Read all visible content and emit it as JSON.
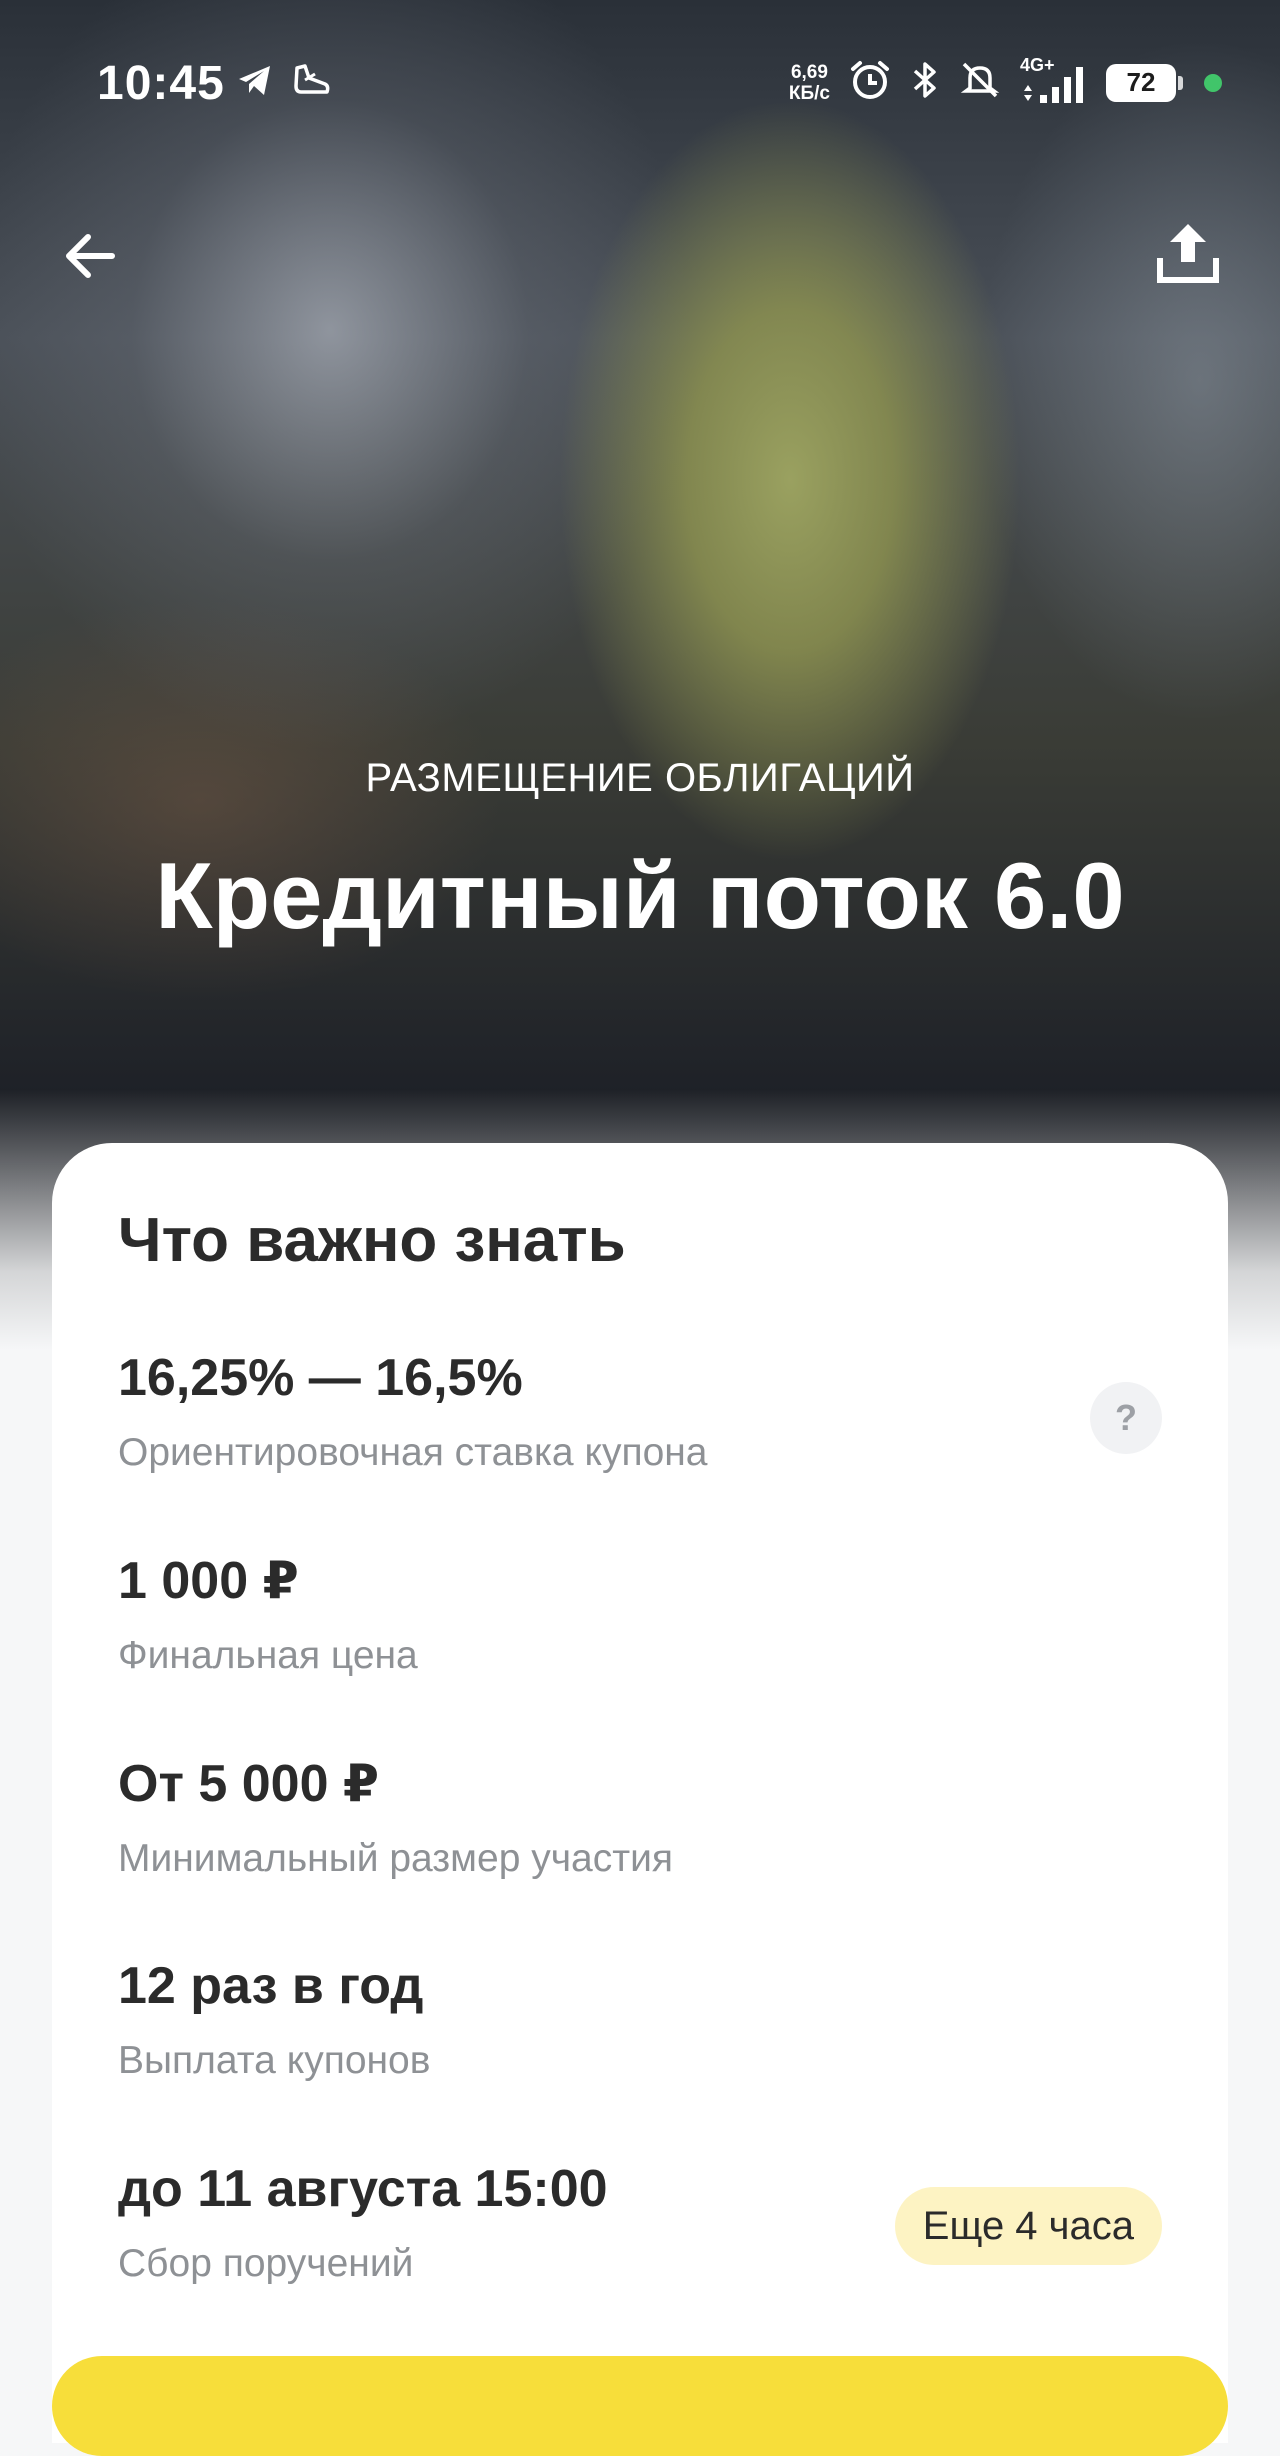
{
  "status_bar": {
    "time": "10:45",
    "net_speed_value": "6,69",
    "net_speed_unit": "КБ/с",
    "network_type": "4G+",
    "battery_level": "72",
    "icons": [
      "telegram-icon",
      "sneaker-icon",
      "alarm-icon",
      "bluetooth-icon",
      "mute-icon",
      "signal-icon",
      "battery-icon"
    ]
  },
  "nav": {
    "back_icon": "arrow-left-icon",
    "share_icon": "upload-icon"
  },
  "hero": {
    "subtitle": "РАЗМЕЩЕНИЕ ОБЛИГАЦИЙ",
    "title": "Кредитный поток 6.0"
  },
  "card": {
    "title": "Что важно знать",
    "rows": [
      {
        "value": "16,25% — 16,5%",
        "label": "Ориентировочная ставка купона",
        "help": "?"
      },
      {
        "value": "1 000 ₽",
        "label": "Финальная цена"
      },
      {
        "value": "От 5 000 ₽",
        "label": "Минимальный размер участия"
      },
      {
        "value": "12 раз в год",
        "label": "Выплата купонов"
      },
      {
        "value": "до 11 августа 15:00",
        "label": "Сбор поручений",
        "badge": "Еще 4 часа"
      }
    ]
  },
  "colors": {
    "accent_yellow": "#f7de3a",
    "badge_bg": "#fdf3c3",
    "text_primary": "#2b2b2b",
    "text_secondary": "#8e9195",
    "status_green": "#41c56a"
  }
}
